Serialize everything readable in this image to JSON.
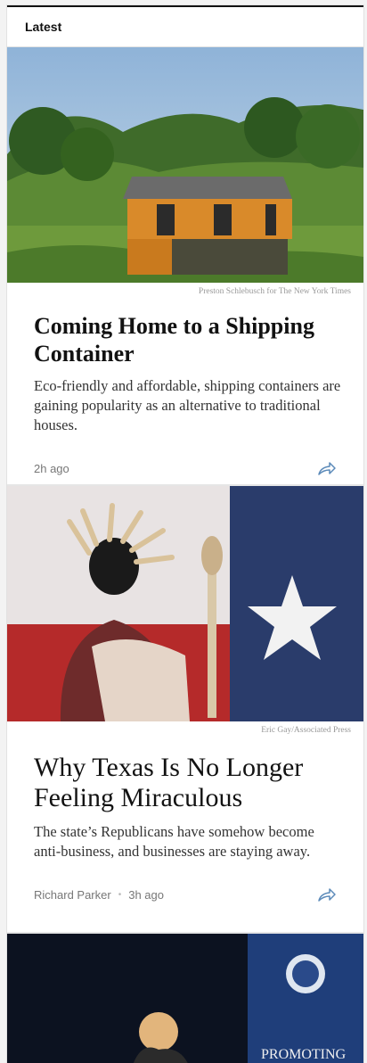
{
  "section": {
    "title": "Latest"
  },
  "articles": [
    {
      "credit": "Preston Schlebusch for The New York Times",
      "headline": "Coming Home to a Shipping Container",
      "summary": "Eco-friendly and affordable, shipping containers are gaining popularity as an alternative to traditional houses.",
      "byline": "",
      "time": "2h ago",
      "share_icon": "share-icon"
    },
    {
      "credit": "Eric Gay/Associated Press",
      "headline": "Why Texas Is No Longer Feeling Miraculous",
      "summary": "The state’s Republicans have somehow become anti-business, and businesses are staying away.",
      "byline": "Richard Parker",
      "time": "3h ago",
      "share_icon": "share-icon"
    },
    {
      "banner_text": "PROMOTING"
    }
  ],
  "colors": {
    "accent": "#121212",
    "share": "#5b8ab9"
  }
}
